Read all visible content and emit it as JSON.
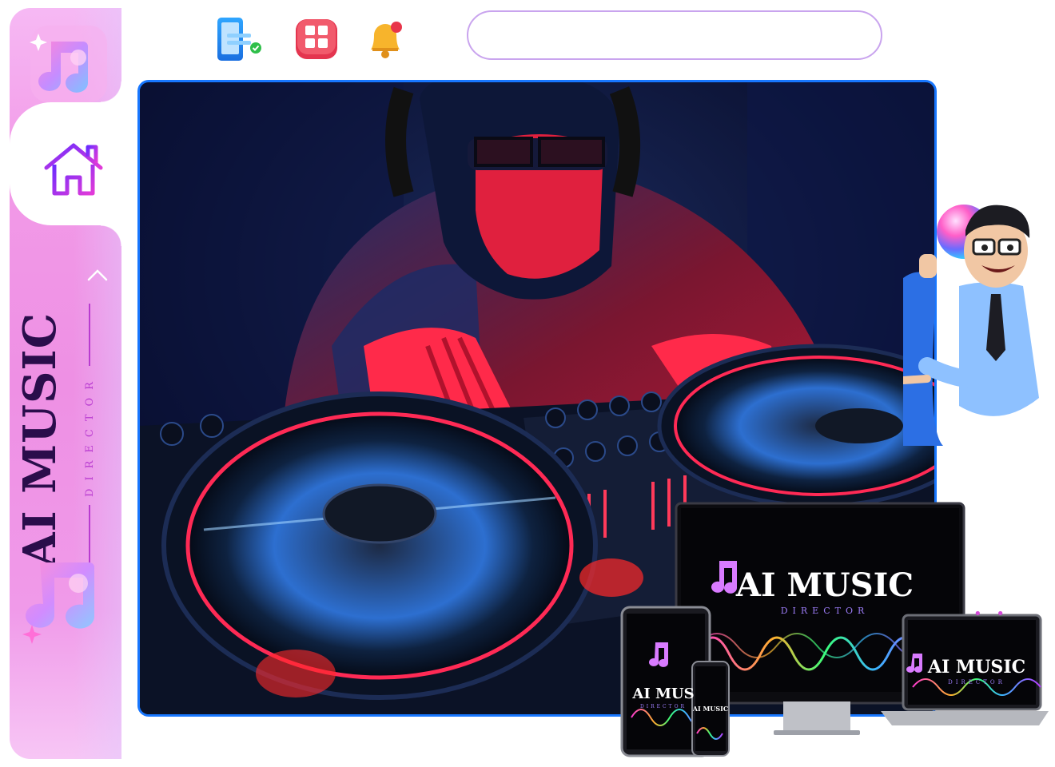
{
  "app": {
    "brand_title": "AI MUSIC",
    "brand_subtitle": "DIRECTOR"
  },
  "sidebar": {
    "active_item": "home",
    "collapse_icon": "chevron-up-icon"
  },
  "toolbar": {
    "icons": [
      "mobile-check-icon",
      "apps-grid-icon",
      "notification-bell-icon"
    ],
    "search": {
      "value": "",
      "placeholder": ""
    }
  },
  "promo": {
    "monitor_title": "AI MUSIC",
    "monitor_subtitle": "DIRECTOR",
    "tablet_title": "AI MUS",
    "tablet_subtitle": "DIRECTOR",
    "phone_title": "AI MUSIC",
    "laptop_title": "AI MUSIC",
    "laptop_subtitle": "DIRECTOR"
  },
  "colors": {
    "accent_pink": "#ee90e4",
    "brand_dark": "#2a0d4b",
    "hero_border": "#1877ff",
    "search_border": "#c9a4ee"
  }
}
